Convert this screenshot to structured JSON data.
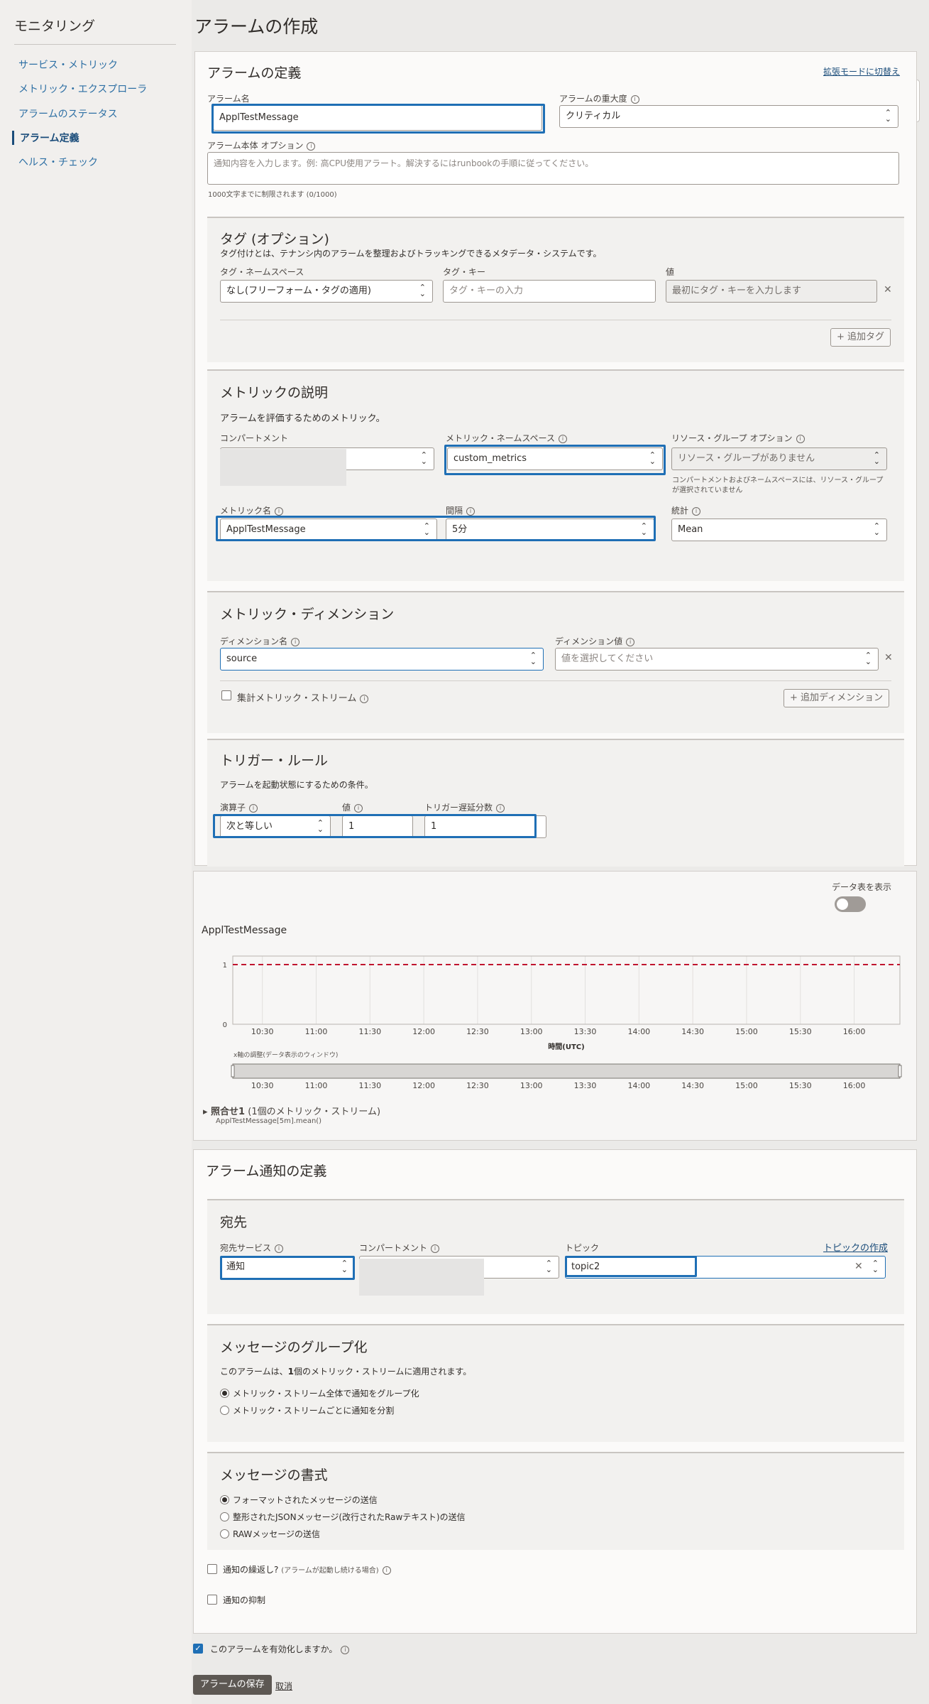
{
  "sidebar": {
    "title": "モニタリング",
    "items": [
      "サービス・メトリック",
      "メトリック・エクスプローラ",
      "アラームのステータス",
      "アラーム定義",
      "ヘルス・チェック"
    ],
    "active_index": 3
  },
  "page_title": "アラームの作成",
  "definition": {
    "title": "アラームの定義",
    "advanced_link": "拡張モードに切替え",
    "alarm_name_label": "アラーム名",
    "alarm_name_value": "ApplTestMessage",
    "severity_label": "アラームの重大度",
    "severity_value": "クリティカル",
    "body_label": "アラーム本体 オプション",
    "body_placeholder": "通知内容を入力します。例: 高CPU使用アラート。解決するにはrunbookの手順に従ってください。",
    "body_hint": "1000文字までに制限されます (0/1000)"
  },
  "tags": {
    "title": "タグ (オプション)",
    "desc": "タグ付けとは、テナンシ内のアラームを整理およびトラッキングできるメタデータ・システムです。",
    "namespace_label": "タグ・ネームスペース",
    "namespace_value": "なし(フリーフォーム・タグの適用)",
    "key_label": "タグ・キー",
    "key_placeholder": "タグ・キーの入力",
    "value_label": "値",
    "value_placeholder": "最初にタグ・キーを入力します",
    "add_button": "+ 追加タグ"
  },
  "metric": {
    "title": "メトリックの説明",
    "desc": "アラームを評価するためのメトリック。",
    "compartment_label": "コンパートメント",
    "namespace_label": "メトリック・ネームスペース",
    "namespace_value": "custom_metrics",
    "resource_group_label": "リソース・グループ オプション",
    "resource_group_value": "リソース・グループがありません",
    "resource_group_note_1": "コンパートメントおよびネームスペースには、リソース・グループ",
    "resource_group_note_2": "が選択されていません",
    "metric_name_label": "メトリック名",
    "metric_name_value": "ApplTestMessage",
    "interval_label": "間隔",
    "interval_value": "5分",
    "statistic_label": "統計",
    "statistic_value": "Mean"
  },
  "dimension": {
    "title": "メトリック・ディメンション",
    "name_label": "ディメンション名",
    "name_value": "source",
    "value_label": "ディメンション値",
    "value_placeholder": "値を選択してください",
    "aggregate_label": "集計メトリック・ストリーム",
    "add_button": "+ 追加ディメンション"
  },
  "trigger": {
    "title": "トリガー・ルール",
    "desc": "アラームを起動状態にするための条件。",
    "operator_label": "演算子",
    "operator_value": "次と等しい",
    "value_label": "値",
    "value_value": "1",
    "delay_label": "トリガー遅延分数",
    "delay_value": "1"
  },
  "chart": {
    "toggle_label": "データ表を表示",
    "title": "ApplTestMessage",
    "xlabel": "時間(UTC)",
    "window_label": "x軸の調整(データ表示のウィンドウ)",
    "legend_title": "▸ 照合せ1",
    "legend_sub": "(1個のメトリック・ストリーム)",
    "legend_query": "ApplTestMessage[5m].mean()"
  },
  "chart_data": {
    "type": "line",
    "x": [
      "10:30",
      "11:00",
      "11:30",
      "12:00",
      "12:30",
      "13:00",
      "13:30",
      "14:00",
      "14:30",
      "15:00",
      "15:30",
      "16:00"
    ],
    "ytick_labels": [
      "0",
      "1"
    ],
    "ylim": [
      0,
      1
    ],
    "threshold": 1,
    "series": [],
    "xlabel": "時間(UTC)",
    "title": "ApplTestMessage",
    "grid": true
  },
  "notification": {
    "title": "アラーム通知の定義",
    "dest_title": "宛先",
    "service_label": "宛先サービス",
    "service_value": "通知",
    "compartment_label": "コンパートメント",
    "topic_label": "トピック",
    "topic_value": "topic2",
    "create_topic": "トピックの作成",
    "grouping_title": "メッセージのグループ化",
    "grouping_desc_1": "このアラームは、",
    "grouping_desc_2": "1",
    "grouping_desc_3": "個のメトリック・ストリームに適用されます。",
    "grouping_opt1": "メトリック・ストリーム全体で通知をグループ化",
    "grouping_opt2": "メトリック・ストリームごとに通知を分割",
    "format_title": "メッセージの書式",
    "format_opt1": "フォーマットされたメッセージの送信",
    "format_opt2": "整形されたJSONメッセージ(改行されたRawテキスト)の送信",
    "format_opt3": "RAWメッセージの送信",
    "repeat_label": "通知の繰返し?",
    "repeat_note": "(アラームが起動し続ける場合)",
    "suppress_label": "通知の抑制"
  },
  "enable_label": "このアラームを有効化しますか。",
  "save_button": "アラームの保存",
  "cancel_link": "取消"
}
